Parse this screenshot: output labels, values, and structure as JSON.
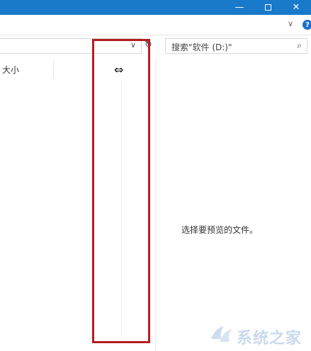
{
  "window": {
    "minimize_glyph": "—",
    "close_glyph": "✕"
  },
  "ribbon": {
    "expand_glyph": "∨",
    "help_glyph": "?"
  },
  "addressbar": {
    "dropdown_glyph": "∨",
    "refresh_glyph": "↻"
  },
  "search": {
    "placeholder": "搜索\"软件 (D:)\"",
    "icon_glyph": "⌕"
  },
  "columns": {
    "size_label": "大小"
  },
  "cursor": {
    "resize_glyph": "⇔"
  },
  "preview": {
    "empty_message": "选择要预览的文件。"
  },
  "watermark": {
    "text": "系统之家"
  },
  "colors": {
    "titlebar": "#1979ca",
    "highlight": "#b41d23"
  }
}
